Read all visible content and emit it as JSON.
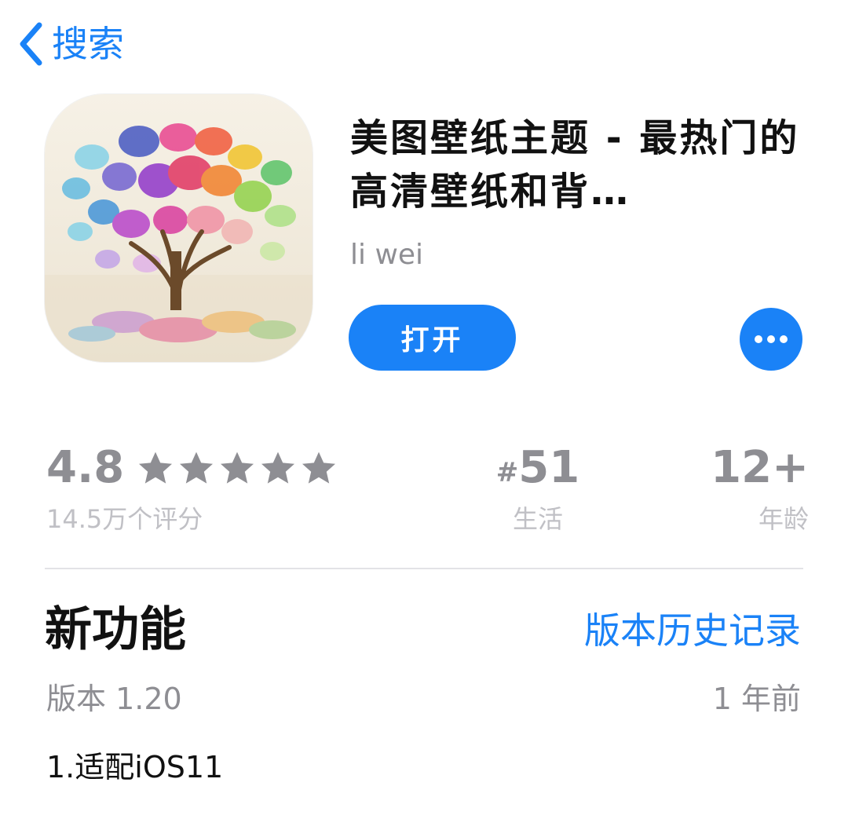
{
  "nav": {
    "back_label": "搜索"
  },
  "app": {
    "title": "美图壁纸主题 - 最热门的高清壁纸和背…",
    "developer": "li wei",
    "open_label": "打开",
    "icon_name": "rainbow-tree-app-icon",
    "more_icon": "ellipsis-icon"
  },
  "stats": {
    "rating": {
      "value": "4.8",
      "stars": 5,
      "caption": "14.5万个评分"
    },
    "rank": {
      "hash": "#",
      "value": "51",
      "caption": "生活"
    },
    "age": {
      "value": "12+",
      "caption": "年龄"
    }
  },
  "whats_new": {
    "title": "新功能",
    "history_link": "版本历史记录",
    "version": "版本 1.20",
    "date": "1 年前",
    "notes": "1.适配iOS11"
  },
  "colors": {
    "accent": "#1a82f7",
    "secondary_text": "#8e8e93",
    "tertiary_text": "#c0c0c5",
    "primary_text": "#111111"
  }
}
